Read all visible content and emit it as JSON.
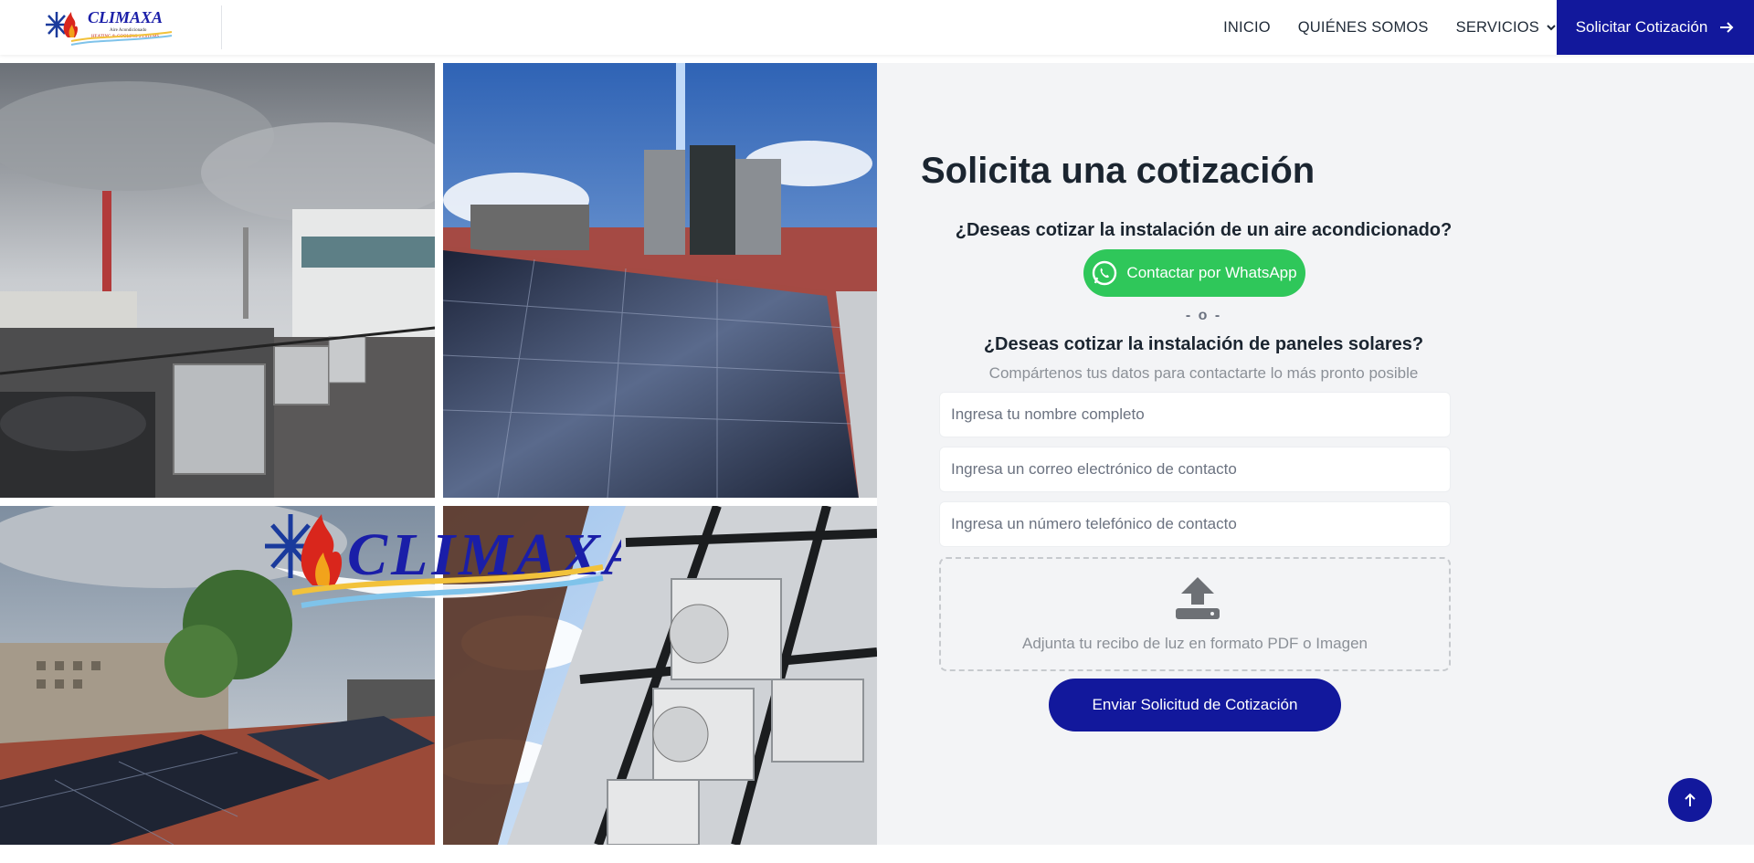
{
  "header": {
    "logo_text": "CLIMAXA",
    "logo_tagline1": "Aire Acondicionado",
    "logo_tagline2": "HEATING & COOLING SYSTEMS",
    "nav": [
      {
        "label": "INICIO"
      },
      {
        "label": "QUIÉNES SOMOS"
      },
      {
        "label": "SERVICIOS"
      }
    ],
    "cta_label": "Solicitar Cotización"
  },
  "collage": {
    "logo_text": "CLIMAXA"
  },
  "form": {
    "title": "Solicita una cotización",
    "question_ac": "¿Deseas cotizar la instalación de un aire acondicionado?",
    "whatsapp_label": "Contactar por WhatsApp",
    "separator": "- o -",
    "question_solar": "¿Deseas cotizar la instalación de paneles solares?",
    "subtitle": "Compártenos tus datos para contactarte lo más pronto posible",
    "name_placeholder": "Ingresa tu nombre completo",
    "email_placeholder": "Ingresa un correo electrónico de contacto",
    "phone_placeholder": "Ingresa un número telefónico de contacto",
    "upload_label": "Adjunta tu recibo de luz en formato PDF o Imagen",
    "submit_label": "Enviar Solicitud de Cotización"
  },
  "colors": {
    "brand_blue": "#12189c",
    "whatsapp_green": "#2fc75a",
    "panel_bg": "#f3f4f6"
  }
}
